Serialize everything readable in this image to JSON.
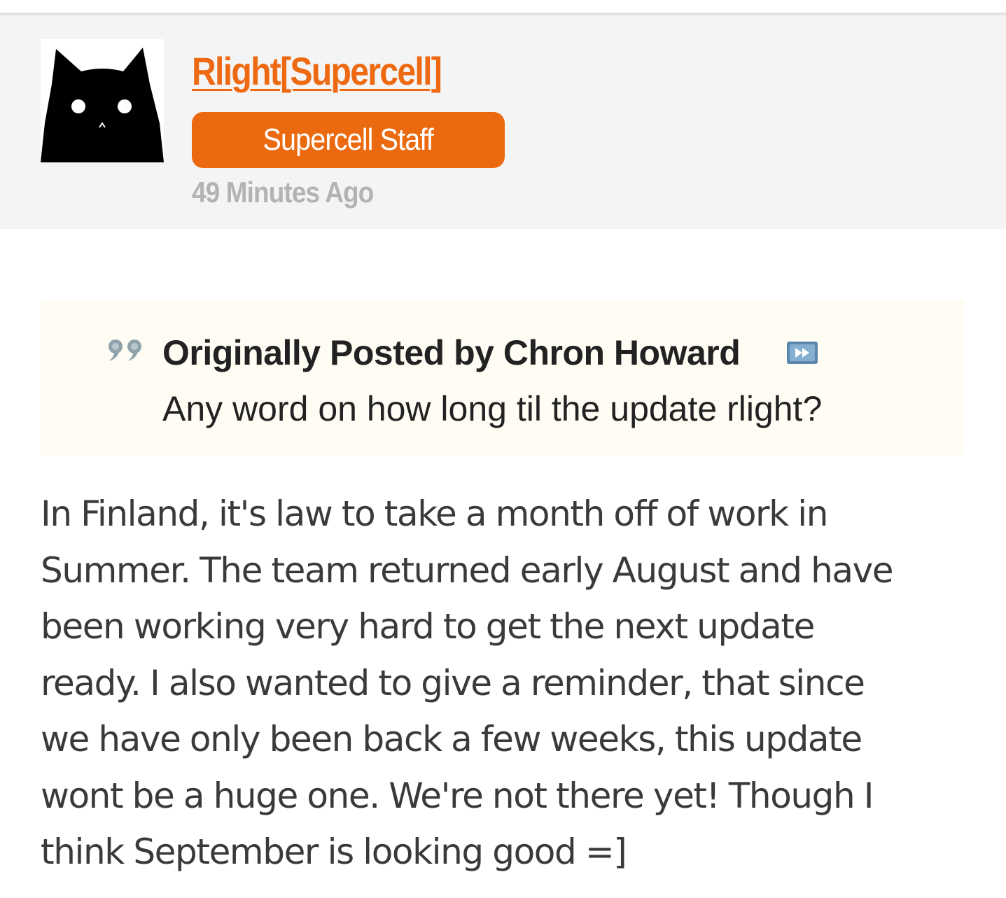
{
  "post": {
    "author": {
      "username": "Rlight[Supercell]",
      "badge": "Supercell Staff",
      "avatar_icon": "black-cat-icon"
    },
    "timestamp": "49 Minutes Ago",
    "quote": {
      "icon": "quote-icon",
      "attribution": "Originally Posted by Chron Howard",
      "link_icon": "view-post-icon",
      "text": "Any word on how long til the update rlight?"
    },
    "body": "In Finland, it's law to take a month off of work in\nSummer. The team returned early August and have\nbeen working very hard to get the next update\nready. I also wanted to give a reminder, that since\nwe have only been back a few weeks, this update\nwont be a huge one. We're not there yet! Though I\nthink September is looking good =]"
  },
  "colors": {
    "accent": "#ec6a0f",
    "header_bg": "#f4f4f4",
    "quote_bg": "#fefcf3",
    "timestamp": "#b3b3b3",
    "body_text": "#3a3a3a"
  }
}
